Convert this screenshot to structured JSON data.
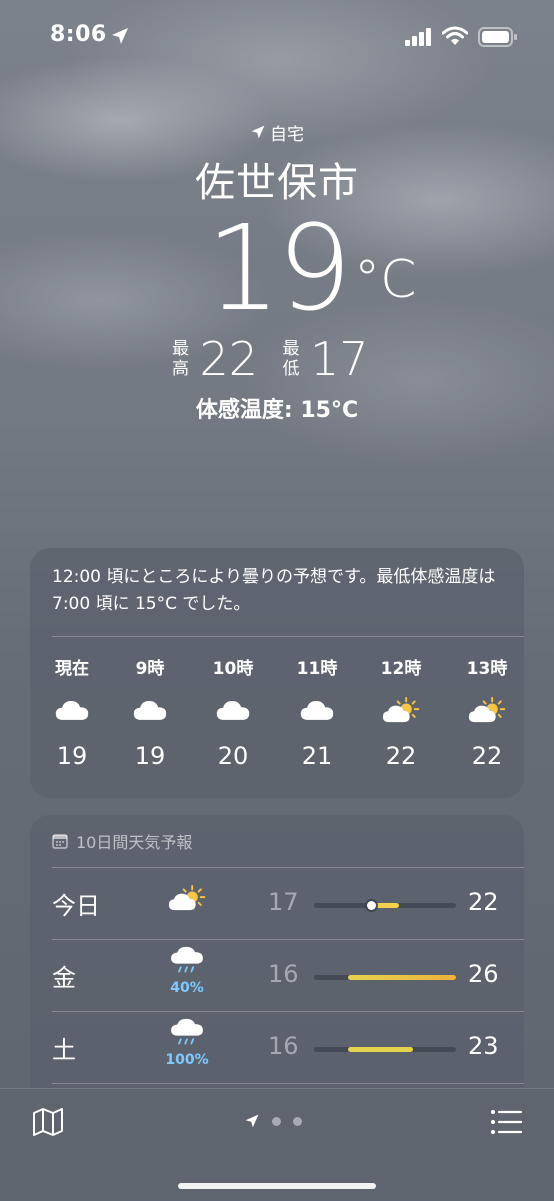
{
  "status_bar": {
    "time": "8:06"
  },
  "header": {
    "home_label": "自宅",
    "city": "佐世保市",
    "temperature": "19",
    "unit": "°C",
    "high_label": "最高",
    "high": "22",
    "low_label": "最低",
    "low": "17",
    "feels_like": "体感温度: 15°C"
  },
  "hourly": {
    "summary": "12:00 頃にところにより曇りの予想です。最低体感温度は 7:00 頃に 15°C でした。",
    "items": [
      {
        "label": "現在",
        "icon": "cloud-icon",
        "temp": "19"
      },
      {
        "label": "9時",
        "icon": "cloud-icon",
        "temp": "19"
      },
      {
        "label": "10時",
        "icon": "cloud-icon",
        "temp": "20"
      },
      {
        "label": "11時",
        "icon": "cloud-icon",
        "temp": "21"
      },
      {
        "label": "12時",
        "icon": "partly-sunny-icon",
        "temp": "22"
      },
      {
        "label": "13時",
        "icon": "partly-sunny-icon",
        "temp": "22"
      }
    ]
  },
  "daily": {
    "title": "10日間天気予報",
    "range_min": 16,
    "range_max": 26,
    "days": [
      {
        "name": "今日",
        "icon": "partly-sunny-icon",
        "pop": "",
        "low": "17",
        "high": "22",
        "low_val": 17,
        "high_val": 22,
        "current": 19,
        "color": "#f1d24a"
      },
      {
        "name": "金",
        "icon": "rain-cloud-icon",
        "pop": "40%",
        "low": "16",
        "high": "26",
        "low_val": 16,
        "high_val": 26,
        "color": "#eeb23a"
      },
      {
        "name": "土",
        "icon": "rain-cloud-icon",
        "pop": "100%",
        "low": "16",
        "high": "23",
        "low_val": 16,
        "high_val": 23,
        "color": "#e5d24f"
      }
    ]
  },
  "toolbar": {
    "pages": 3,
    "current_page": "location-arrow-icon"
  },
  "colors": {
    "precip": "#7ec9ff",
    "sun": "#f6c543",
    "background": "#6b717a"
  }
}
